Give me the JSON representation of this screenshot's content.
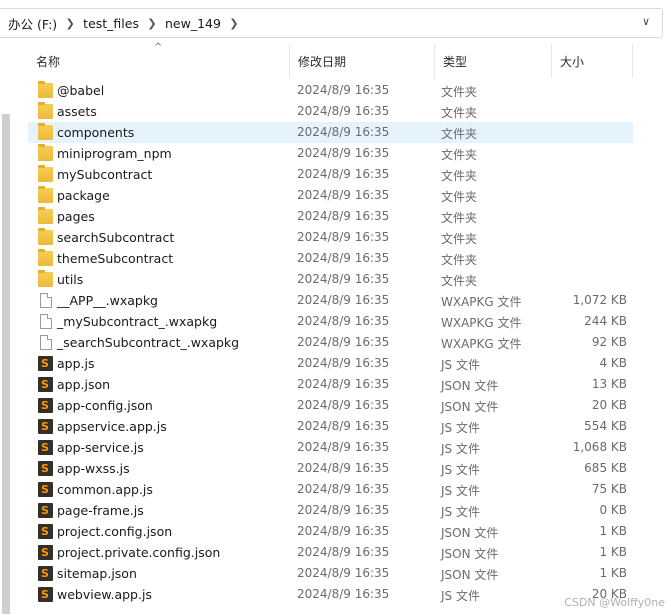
{
  "breadcrumb": [
    "办公 (F:)",
    "test_files",
    "new_149"
  ],
  "icons": {
    "separator": "chevron-right-icon",
    "dropdown": "chevron-down-icon",
    "sort": "sort-up-icon"
  },
  "columns": {
    "name": "名称",
    "date": "修改日期",
    "type": "类型",
    "size": "大小"
  },
  "files": [
    {
      "name": "@babel",
      "date": "2024/8/9 16:35",
      "type": "文件夹",
      "size": "",
      "kind": "folder"
    },
    {
      "name": "assets",
      "date": "2024/8/9 16:35",
      "type": "文件夹",
      "size": "",
      "kind": "folder"
    },
    {
      "name": "components",
      "date": "2024/8/9 16:35",
      "type": "文件夹",
      "size": "",
      "kind": "folder",
      "selected": true
    },
    {
      "name": "miniprogram_npm",
      "date": "2024/8/9 16:35",
      "type": "文件夹",
      "size": "",
      "kind": "folder"
    },
    {
      "name": "mySubcontract",
      "date": "2024/8/9 16:35",
      "type": "文件夹",
      "size": "",
      "kind": "folder"
    },
    {
      "name": "package",
      "date": "2024/8/9 16:35",
      "type": "文件夹",
      "size": "",
      "kind": "folder"
    },
    {
      "name": "pages",
      "date": "2024/8/9 16:35",
      "type": "文件夹",
      "size": "",
      "kind": "folder"
    },
    {
      "name": "searchSubcontract",
      "date": "2024/8/9 16:35",
      "type": "文件夹",
      "size": "",
      "kind": "folder"
    },
    {
      "name": "themeSubcontract",
      "date": "2024/8/9 16:35",
      "type": "文件夹",
      "size": "",
      "kind": "folder"
    },
    {
      "name": "utils",
      "date": "2024/8/9 16:35",
      "type": "文件夹",
      "size": "",
      "kind": "folder"
    },
    {
      "name": "__APP__.wxapkg",
      "date": "2024/8/9 16:35",
      "type": "WXAPKG 文件",
      "size": "1,072 KB",
      "kind": "doc"
    },
    {
      "name": "_mySubcontract_.wxapkg",
      "date": "2024/8/9 16:35",
      "type": "WXAPKG 文件",
      "size": "244 KB",
      "kind": "doc"
    },
    {
      "name": "_searchSubcontract_.wxapkg",
      "date": "2024/8/9 16:35",
      "type": "WXAPKG 文件",
      "size": "92 KB",
      "kind": "doc"
    },
    {
      "name": "app.js",
      "date": "2024/8/9 16:35",
      "type": "JS 文件",
      "size": "4 KB",
      "kind": "sub"
    },
    {
      "name": "app.json",
      "date": "2024/8/9 16:35",
      "type": "JSON 文件",
      "size": "13 KB",
      "kind": "sub"
    },
    {
      "name": "app-config.json",
      "date": "2024/8/9 16:35",
      "type": "JSON 文件",
      "size": "20 KB",
      "kind": "sub"
    },
    {
      "name": "appservice.app.js",
      "date": "2024/8/9 16:35",
      "type": "JS 文件",
      "size": "554 KB",
      "kind": "sub"
    },
    {
      "name": "app-service.js",
      "date": "2024/8/9 16:35",
      "type": "JS 文件",
      "size": "1,068 KB",
      "kind": "sub"
    },
    {
      "name": "app-wxss.js",
      "date": "2024/8/9 16:35",
      "type": "JS 文件",
      "size": "685 KB",
      "kind": "sub"
    },
    {
      "name": "common.app.js",
      "date": "2024/8/9 16:35",
      "type": "JS 文件",
      "size": "75 KB",
      "kind": "sub"
    },
    {
      "name": "page-frame.js",
      "date": "2024/8/9 16:35",
      "type": "JS 文件",
      "size": "0 KB",
      "kind": "sub"
    },
    {
      "name": "project.config.json",
      "date": "2024/8/9 16:35",
      "type": "JSON 文件",
      "size": "1 KB",
      "kind": "sub"
    },
    {
      "name": "project.private.config.json",
      "date": "2024/8/9 16:35",
      "type": "JSON 文件",
      "size": "1 KB",
      "kind": "sub"
    },
    {
      "name": "sitemap.json",
      "date": "2024/8/9 16:35",
      "type": "JSON 文件",
      "size": "1 KB",
      "kind": "sub"
    },
    {
      "name": "webview.app.js",
      "date": "2024/8/9 16:35",
      "type": "JS 文件",
      "size": "20 KB",
      "kind": "sub"
    }
  ],
  "watermark": "CSDN @Wolffy0ne",
  "colors": {
    "selected_row": "#e5f3ff",
    "folder": "#f2c244",
    "sublime_icon_bg": "#33302b",
    "sublime_icon_fg": "#ff9800"
  }
}
